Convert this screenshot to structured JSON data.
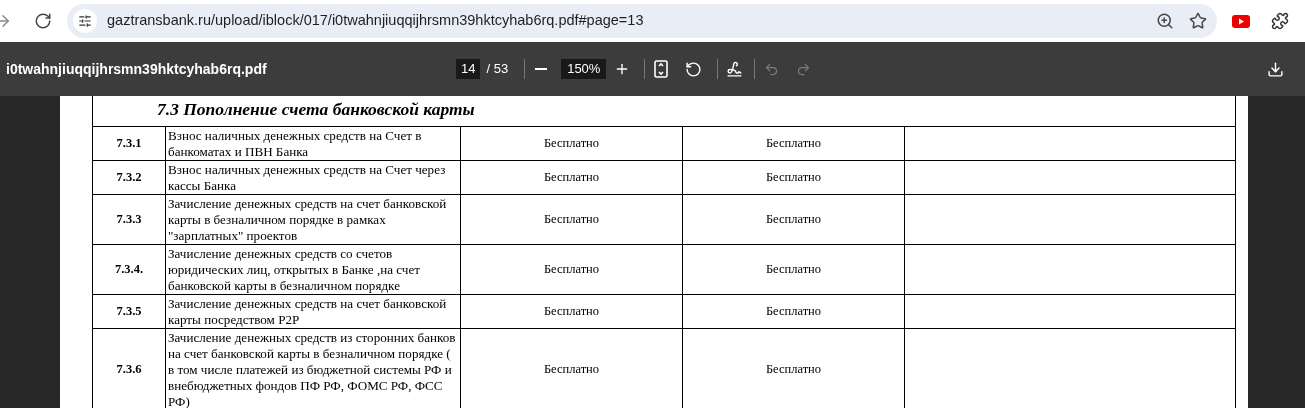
{
  "browser": {
    "url": "gaztransbank.ru/upload/iblock/017/i0twahnjiuqqijhrsmn39hktcyhab6rq.pdf#page=13"
  },
  "pdf_toolbar": {
    "filename": "i0twahnjiuqqijhrsmn39hktcyhab6rq.pdf",
    "page": "14",
    "total_pages": "/ 53",
    "zoom": "150%",
    "undo": {
      "disabled": true
    },
    "redo": {
      "disabled": true
    }
  },
  "document": {
    "section_title": "7.3 Пополнение счета банковской карты",
    "rows": [
      {
        "number": "7.3.1",
        "description": "Взнос наличных денежных средств на Счет в банкоматах и ПВН Банка",
        "column_3": "Бесплатно",
        "column_4": "Бесплатно"
      },
      {
        "number": "7.3.2",
        "description": "Взнос наличных денежных средств на Счет через кассы Банка",
        "column_3": "Бесплатно",
        "column_4": "Бесплатно"
      },
      {
        "number": "7.3.3",
        "description": "Зачисление денежных средств на счет банковской карты в безналичном порядке в рамках \"зарплатных\" проектов",
        "column_3": "Бесплатно",
        "column_4": "Бесплатно"
      },
      {
        "number": "7.3.4.",
        "description": "Зачисление денежных средств со счетов юридических лиц, открытых в Банке ,на счет банковской карты в безналичном порядке",
        "column_3": "Бесплатно",
        "column_4": "Бесплатно"
      },
      {
        "number": "7.3.5",
        "description": "Зачисление денежных средств на счет банковской карты посредством P2P",
        "column_3": "Бесплатно",
        "column_4": "Бесплатно"
      },
      {
        "number": "7.3.6",
        "description": "Зачисление денежных средств из сторонних банков на счет банковской карты в безналичном порядке ( в том числе платежей из бюджетной системы РФ и внебюджетных фондов ПФ РФ, ФОМС РФ, ФСС РФ)",
        "column_3": "Бесплатно",
        "column_4": "Бесплатно"
      }
    ]
  }
}
